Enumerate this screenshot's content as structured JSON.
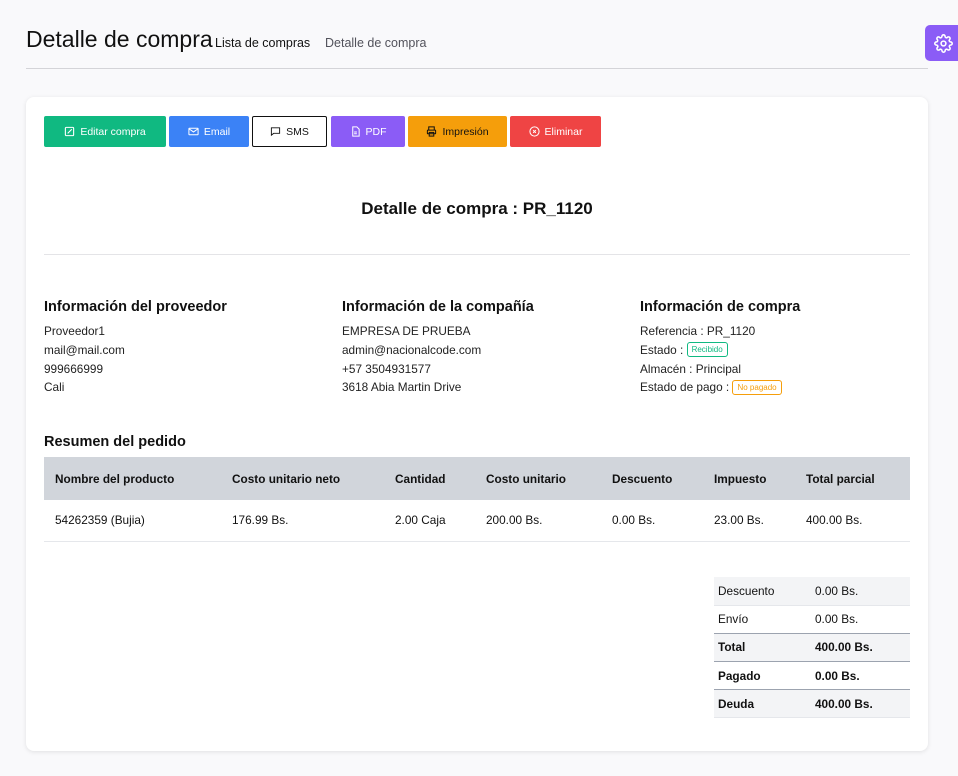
{
  "header": {
    "title": "Detalle de compra",
    "breadcrumb": [
      "Lista de compras",
      "Detalle de compra"
    ]
  },
  "toolbar": {
    "edit": "Editar compra",
    "email": "Email",
    "sms": "SMS",
    "pdf": "PDF",
    "print": "Impresión",
    "delete": "Eliminar"
  },
  "detail_title": "Detalle de compra : PR_1120",
  "supplier": {
    "heading": "Información del proveedor",
    "name": "Proveedor1",
    "email": "mail@mail.com",
    "phone": "999666999",
    "city": "Cali"
  },
  "company": {
    "heading": "Información de la compañía",
    "name": "EMPRESA DE PRUEBA",
    "email": "admin@nacionalcode.com",
    "phone": "+57 3504931577",
    "address": "3618 Abia Martin Drive"
  },
  "purchase": {
    "heading": "Información de compra",
    "reference": "Referencia : PR_1120",
    "status_label": "Estado :",
    "status_badge": "Recibido",
    "warehouse": "Almacén : Principal",
    "payment_label": "Estado de pago :",
    "payment_badge": "No pagado"
  },
  "summary": {
    "title": "Resumen del pedido",
    "columns": [
      "Nombre del producto",
      "Costo unitario neto",
      "Cantidad",
      "Costo unitario",
      "Descuento",
      "Impuesto",
      "Total parcial"
    ],
    "rows": [
      [
        "54262359 (Bujia)",
        "176.99 Bs.",
        "2.00 Caja",
        "200.00 Bs.",
        "0.00 Bs.",
        "23.00 Bs.",
        "400.00 Bs."
      ]
    ]
  },
  "totals": [
    {
      "label": "Descuento",
      "value": "0.00 Bs."
    },
    {
      "label": "Envío",
      "value": "0.00 Bs."
    },
    {
      "label": "Total",
      "value": "400.00 Bs."
    },
    {
      "label": "Pagado",
      "value": "0.00 Bs."
    },
    {
      "label": "Deuda",
      "value": "400.00 Bs."
    }
  ],
  "colors": {
    "edit": "#10b981",
    "email": "#3b82f6",
    "pdf": "#8b5cf6",
    "print": "#f59e0b",
    "delete": "#ef4444",
    "settings": "#8b5cf6"
  }
}
